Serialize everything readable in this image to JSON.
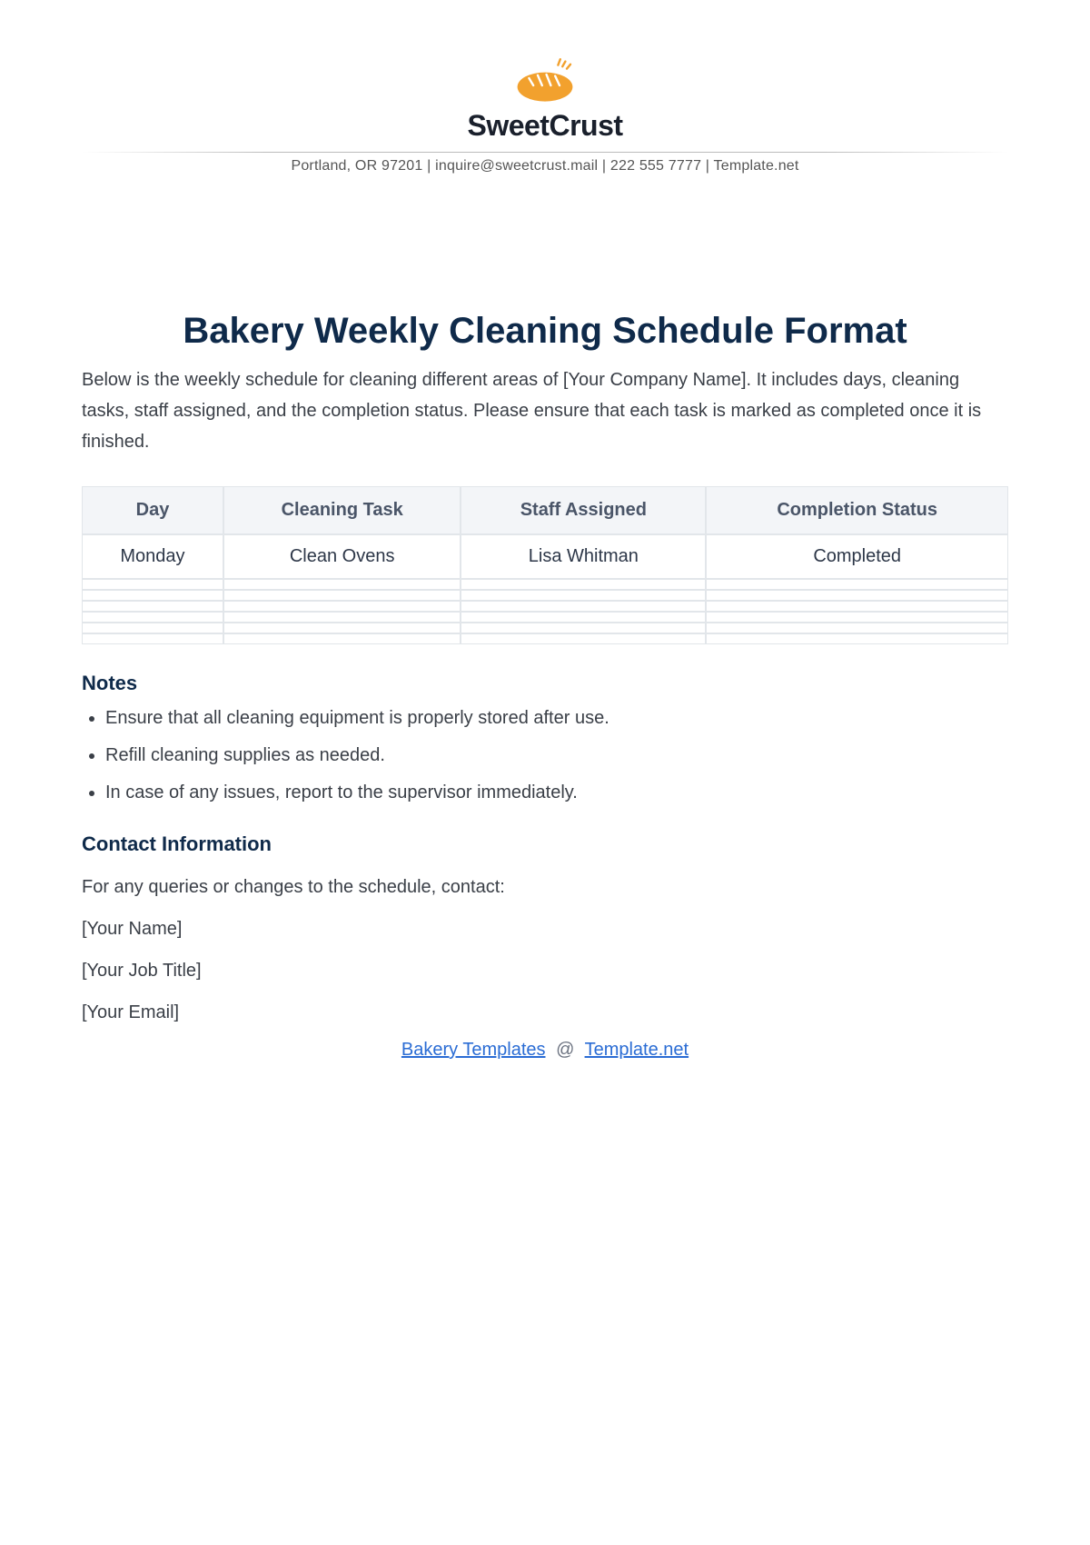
{
  "brand": {
    "name_left": "Sweet",
    "name_right": "Crust",
    "logo_color": "#f2a12e",
    "contact_line": "Portland, OR 97201 | inquire@sweetcrust.mail  | 222 555 7777 | Template.net"
  },
  "title": "Bakery Weekly Cleaning Schedule Format",
  "intro": "Below is the weekly schedule for cleaning different areas of [Your Company Name]. It includes days, cleaning tasks, staff assigned, and the completion status. Please ensure that each task is marked as completed once it is finished.",
  "table": {
    "headers": [
      "Day",
      "Cleaning Task",
      "Staff Assigned",
      "Completion Status"
    ],
    "rows": [
      {
        "day": "Monday",
        "task": "Clean Ovens",
        "staff": "Lisa Whitman",
        "status": "Completed"
      }
    ]
  },
  "notes": {
    "title": "Notes",
    "items": [
      "Ensure that all cleaning equipment is properly stored after use.",
      "Refill cleaning supplies as needed.",
      "In case of any issues, report to the supervisor immediately."
    ]
  },
  "contact": {
    "title": "Contact Information",
    "lead": "For any queries or changes to the schedule, contact:",
    "name": "[Your Name]",
    "job": "[Your Job Title]",
    "email": "[Your Email]"
  },
  "footer": {
    "link1": "Bakery Templates",
    "sep": "@",
    "link2": "Template.net"
  }
}
